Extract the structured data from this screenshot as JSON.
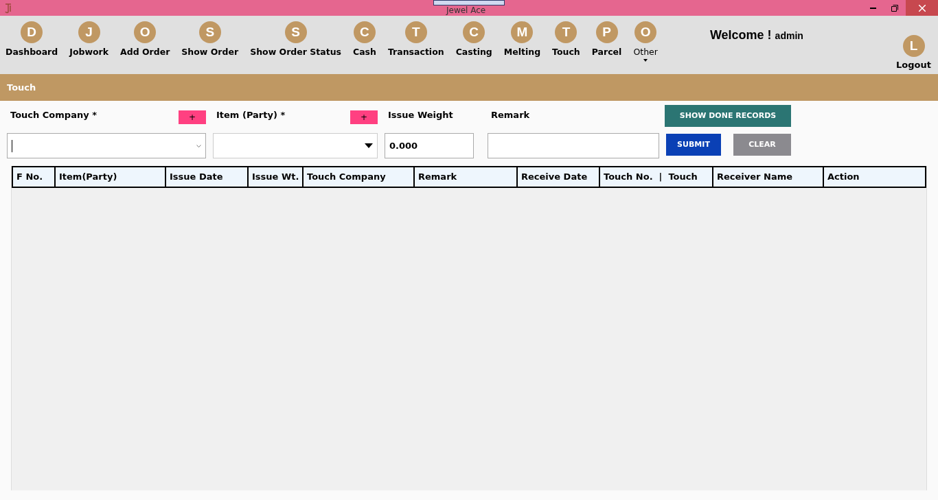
{
  "window": {
    "title": "Jewel Ace"
  },
  "nav": [
    {
      "letter": "D",
      "label": "Dashboard",
      "kind": "link"
    },
    {
      "letter": "J",
      "label": "Jobwork",
      "kind": "link"
    },
    {
      "letter": "O",
      "label": "Add Order",
      "kind": "link"
    },
    {
      "letter": "S",
      "label": "Show Order",
      "kind": "link"
    },
    {
      "letter": "S",
      "label": "Show Order Status",
      "kind": "link"
    },
    {
      "letter": "C",
      "label": "Cash",
      "kind": "link"
    },
    {
      "letter": "T",
      "label": "Transaction",
      "kind": "link"
    },
    {
      "letter": "C",
      "label": "Casting",
      "kind": "link"
    },
    {
      "letter": "M",
      "label": "Melting",
      "kind": "link"
    },
    {
      "letter": "T",
      "label": "Touch",
      "kind": "link"
    },
    {
      "letter": "P",
      "label": "Parcel",
      "kind": "link"
    },
    {
      "letter": "O",
      "label": "Other",
      "kind": "dropdown"
    }
  ],
  "welcome": {
    "greeting": "Welcome !",
    "user": "admin"
  },
  "logout": {
    "letter": "L",
    "label": "Logout"
  },
  "section": {
    "title": "Touch"
  },
  "form": {
    "touch_company": {
      "label": "Touch Company *",
      "add": "+"
    },
    "item_party": {
      "label": "Item (Party) *",
      "add": "+"
    },
    "issue_weight": {
      "label": "Issue Weight",
      "value": "0.000"
    },
    "remark": {
      "label": "Remark"
    },
    "show_done": "SHOW DONE RECORDS",
    "submit": "SUBMIT",
    "clear": "CLEAR"
  },
  "table": {
    "columns": [
      "F No.",
      "Item(Party)",
      "Issue Date",
      "Issue Wt.",
      "Touch Company",
      "Remark",
      "Receive Date",
      "Touch No.  |  Touch",
      "Receiver Name",
      "Action"
    ]
  }
}
